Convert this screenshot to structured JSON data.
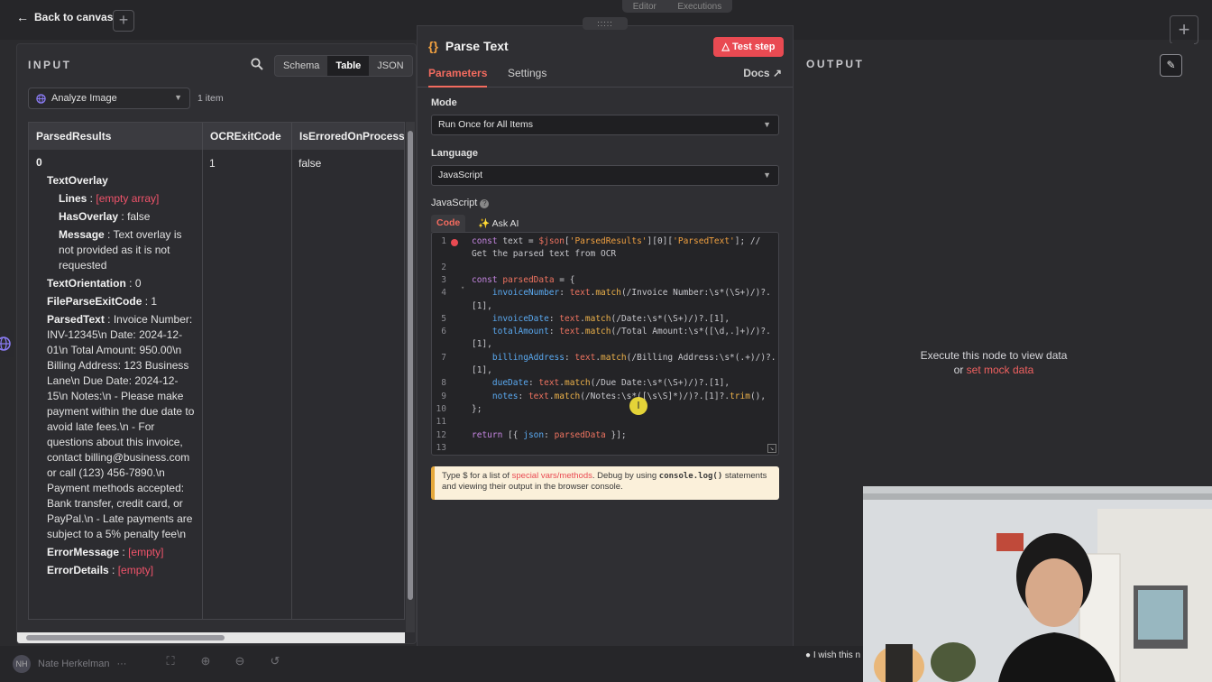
{
  "topbar": {
    "back_label": "Back to canvas",
    "tabs": [
      "Editor",
      "Executions"
    ]
  },
  "input": {
    "title": "INPUT",
    "views": [
      "Schema",
      "Table",
      "JSON"
    ],
    "active_view": "Table",
    "node_select": "Analyze Image",
    "item_count": "1 item",
    "columns": [
      "ParsedResults",
      "OCRExitCode",
      "IsErroredOnProcessi"
    ],
    "row": {
      "index": "0",
      "ocr_exit_code": "1",
      "is_errored": "false",
      "text_overlay_key": "TextOverlay",
      "lines_key": "Lines",
      "lines_val": "[empty array]",
      "has_overlay_key": "HasOverlay",
      "has_overlay_val": "false",
      "message_key": "Message",
      "message_val": "Text overlay is not provided as it is not requested",
      "text_orientation_key": "TextOrientation",
      "text_orientation_val": "0",
      "file_parse_key": "FileParseExitCode",
      "file_parse_val": "1",
      "parsed_text_key": "ParsedText",
      "parsed_text_val": "Invoice Number: INV-12345\\n Date: 2024-12-01\\n Total Amount: 950.00\\n Billing Address: 123 Business Lane\\n Due Date: 2024-12-15\\n Notes:\\n - Please make payment within the due date to avoid late fees.\\n - For questions about this invoice, contact billing@business.com or call (123) 456-7890.\\n Payment methods accepted: Bank transfer, credit card, or PayPal.\\n - Late payments are subject to a 5% penalty fee\\n",
      "error_message_key": "ErrorMessage",
      "error_message_val": "[empty]",
      "error_details_key": "ErrorDetails",
      "error_details_val": "[empty]"
    }
  },
  "node": {
    "title": "Parse Text",
    "test_button": "Test step",
    "tabs": [
      "Parameters",
      "Settings"
    ],
    "docs_label": "Docs",
    "mode_label": "Mode",
    "mode_value": "Run Once for All Items",
    "language_label": "Language",
    "language_value": "JavaScript",
    "code_label": "JavaScript",
    "code_tabs": [
      "Code",
      "Ask AI"
    ],
    "code_lines": [
      {
        "n": "1",
        "text": "const text = $json['ParsedResults'][0]['ParsedText']; //"
      },
      {
        "n": "",
        "text": "Get the parsed text from OCR"
      },
      {
        "n": "2",
        "text": ""
      },
      {
        "n": "3",
        "text": "const parsedData = {"
      },
      {
        "n": "4",
        "text": "    invoiceNumber: text.match(/Invoice Number:\\s*(\\S+)/)?."
      },
      {
        "n": "",
        "text": "[1],"
      },
      {
        "n": "5",
        "text": "    invoiceDate: text.match(/Date:\\s*(\\S+)/)?.[1],"
      },
      {
        "n": "6",
        "text": "    totalAmount: text.match(/Total Amount:\\s*([\\d,.]+)/)?."
      },
      {
        "n": "",
        "text": "[1],"
      },
      {
        "n": "7",
        "text": "    billingAddress: text.match(/Billing Address:\\s*(.+)/)?."
      },
      {
        "n": "",
        "text": "[1],"
      },
      {
        "n": "8",
        "text": "    dueDate: text.match(/Due Date:\\s*(\\S+)/)?.[1],"
      },
      {
        "n": "9",
        "text": "    notes: text.match(/Notes:\\s*([\\s\\S]*)/)?.[1]?.trim(),"
      },
      {
        "n": "10",
        "text": "};"
      },
      {
        "n": "11",
        "text": ""
      },
      {
        "n": "12",
        "text": "return [{ json: parsedData }];"
      },
      {
        "n": "13",
        "text": ""
      }
    ],
    "hint_pre": "Type $ for a list of ",
    "hint_link": "special vars/methods",
    "hint_mid": ". Debug by using ",
    "hint_code": "console.log()",
    "hint_post": " statements and viewing their output in the browser console."
  },
  "output": {
    "title": "OUTPUT",
    "message": "Execute this node to view data",
    "or_label": "or",
    "mock_link": "set mock data"
  },
  "bottom": {
    "user_initials": "NH",
    "user_name": "Nate Herkelman",
    "wish_text": "I wish this n"
  },
  "colors": {
    "accent": "#f36b5f",
    "test_button": "#e94a52",
    "hint_border": "#e5a83b"
  }
}
